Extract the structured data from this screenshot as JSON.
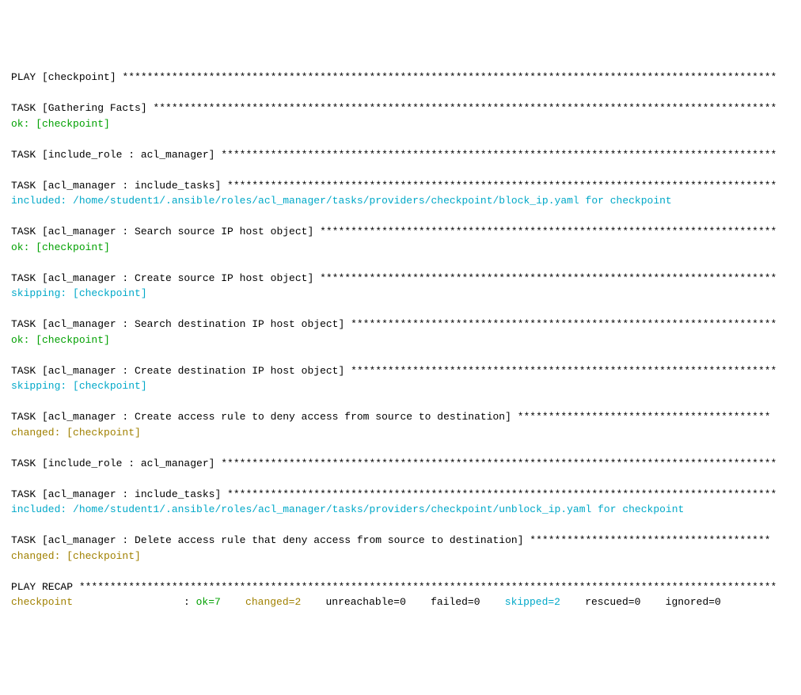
{
  "lines": [
    {
      "segments": [
        {
          "text": "PLAY [checkpoint] **********************************************************************************************************",
          "cls": "black"
        }
      ]
    },
    {
      "segments": [
        {
          "text": "",
          "cls": "black"
        }
      ]
    },
    {
      "segments": [
        {
          "text": "TASK [Gathering Facts] *****************************************************************************************************",
          "cls": "black"
        }
      ]
    },
    {
      "segments": [
        {
          "text": "ok: [checkpoint]",
          "cls": "green"
        }
      ]
    },
    {
      "segments": [
        {
          "text": "",
          "cls": "black"
        }
      ]
    },
    {
      "segments": [
        {
          "text": "TASK [include_role : acl_manager] ******************************************************************************************",
          "cls": "black"
        }
      ]
    },
    {
      "segments": [
        {
          "text": "",
          "cls": "black"
        }
      ]
    },
    {
      "segments": [
        {
          "text": "TASK [acl_manager : include_tasks] *****************************************************************************************",
          "cls": "black"
        }
      ]
    },
    {
      "segments": [
        {
          "text": "included: /home/student1/.ansible/roles/acl_manager/tasks/providers/checkpoint/block_ip.yaml for checkpoint",
          "cls": "cyan"
        }
      ]
    },
    {
      "segments": [
        {
          "text": "",
          "cls": "black"
        }
      ]
    },
    {
      "segments": [
        {
          "text": "TASK [acl_manager : Search source IP host object] **************************************************************************",
          "cls": "black"
        }
      ]
    },
    {
      "segments": [
        {
          "text": "ok: [checkpoint]",
          "cls": "green"
        }
      ]
    },
    {
      "segments": [
        {
          "text": "",
          "cls": "black"
        }
      ]
    },
    {
      "segments": [
        {
          "text": "TASK [acl_manager : Create source IP host object] **************************************************************************",
          "cls": "black"
        }
      ]
    },
    {
      "segments": [
        {
          "text": "skipping: [checkpoint]",
          "cls": "cyan"
        }
      ]
    },
    {
      "segments": [
        {
          "text": "",
          "cls": "black"
        }
      ]
    },
    {
      "segments": [
        {
          "text": "TASK [acl_manager : Search destination IP host object] *********************************************************************",
          "cls": "black"
        }
      ]
    },
    {
      "segments": [
        {
          "text": "ok: [checkpoint]",
          "cls": "green"
        }
      ]
    },
    {
      "segments": [
        {
          "text": "",
          "cls": "black"
        }
      ]
    },
    {
      "segments": [
        {
          "text": "TASK [acl_manager : Create destination IP host object] *********************************************************************",
          "cls": "black"
        }
      ]
    },
    {
      "segments": [
        {
          "text": "skipping: [checkpoint]",
          "cls": "cyan"
        }
      ]
    },
    {
      "segments": [
        {
          "text": "",
          "cls": "black"
        }
      ]
    },
    {
      "segments": [
        {
          "text": "TASK [acl_manager : Create access rule to deny access from source to destination] *****************************************",
          "cls": "black"
        }
      ]
    },
    {
      "segments": [
        {
          "text": "changed: [checkpoint]",
          "cls": "olive"
        }
      ]
    },
    {
      "segments": [
        {
          "text": "",
          "cls": "black"
        }
      ]
    },
    {
      "segments": [
        {
          "text": "TASK [include_role : acl_manager] ******************************************************************************************",
          "cls": "black"
        }
      ]
    },
    {
      "segments": [
        {
          "text": "",
          "cls": "black"
        }
      ]
    },
    {
      "segments": [
        {
          "text": "TASK [acl_manager : include_tasks] *****************************************************************************************",
          "cls": "black"
        }
      ]
    },
    {
      "segments": [
        {
          "text": "included: /home/student1/.ansible/roles/acl_manager/tasks/providers/checkpoint/unblock_ip.yaml for checkpoint",
          "cls": "cyan"
        }
      ]
    },
    {
      "segments": [
        {
          "text": "",
          "cls": "black"
        }
      ]
    },
    {
      "segments": [
        {
          "text": "TASK [acl_manager : Delete access rule that deny access from source to destination] ***************************************",
          "cls": "black"
        }
      ]
    },
    {
      "segments": [
        {
          "text": "changed: [checkpoint]",
          "cls": "olive"
        }
      ]
    },
    {
      "segments": [
        {
          "text": "",
          "cls": "black"
        }
      ]
    },
    {
      "segments": [
        {
          "text": "PLAY RECAP *****************************************************************************************************************",
          "cls": "black"
        }
      ]
    }
  ],
  "recap": {
    "host": "checkpoint",
    "sep": ": ",
    "ok": "ok=7",
    "changed": "changed=2",
    "unreachable": "unreachable=0",
    "failed": "failed=0",
    "skipped": "skipped=2",
    "rescued": "rescued=0",
    "ignored": "ignored=0",
    "gap": "    "
  }
}
